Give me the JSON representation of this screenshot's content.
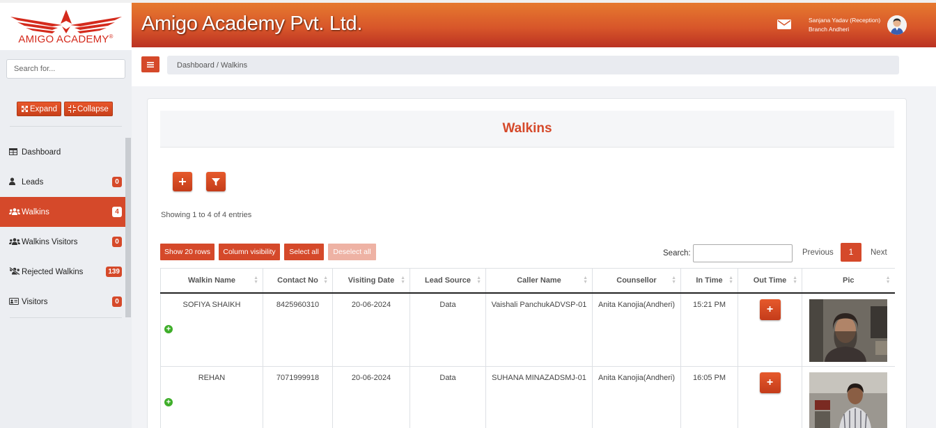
{
  "brand": {
    "logo_text": "AMIGO ACADEMY",
    "logo_reg": "®",
    "app_title": "Amigo Academy Pvt. Ltd.",
    "accent": "#d5492a"
  },
  "user": {
    "name_role": "Sanjana Yadav (Reception)",
    "branch": "Branch Andheri"
  },
  "sidebar": {
    "search_placeholder": "Search for...",
    "expand_label": "Expand",
    "collapse_label": "Collapse",
    "items": [
      {
        "label": "Dashboard",
        "icon": "dashboard-icon",
        "badge": ""
      },
      {
        "label": "Leads",
        "icon": "user-icon",
        "badge": "0"
      },
      {
        "label": "Walkins",
        "icon": "users-icon",
        "badge": "4",
        "active": true
      },
      {
        "label": "Walkins Visitors",
        "icon": "users-icon",
        "badge": "0"
      },
      {
        "label": "Rejected Walkins",
        "icon": "users-slash-icon",
        "badge": "139"
      },
      {
        "label": "Visitors",
        "icon": "id-card-icon",
        "badge": "0"
      }
    ]
  },
  "breadcrumb": "Dashboard / Walkins",
  "page": {
    "title": "Walkins",
    "info": "Showing 1 to 4 of 4 entries",
    "toolbar": {
      "show_rows": "Show 20 rows",
      "column_visibility": "Column visibility",
      "select_all": "Select all",
      "deselect_all": "Deselect all"
    },
    "search_label": "Search:",
    "pagination": {
      "prev": "Previous",
      "current": "1",
      "next": "Next"
    }
  },
  "table": {
    "columns": [
      "Walkin Name",
      "Contact No",
      "Visiting Date",
      "Lead Source",
      "Caller Name",
      "Counsellor",
      "In Time",
      "Out Time",
      "Pic"
    ],
    "rows": [
      {
        "name": "SOFIYA SHAIKH",
        "contact": "8425960310",
        "date": "20-06-2024",
        "source": "Data",
        "caller": "Vaishali PanchukADVSP-01",
        "counsellor": "Anita Kanojia(Andheri)",
        "in_time": "15:21 PM"
      },
      {
        "name": "REHAN",
        "contact": "7071999918",
        "date": "20-06-2024",
        "source": "Data",
        "caller": "SUHANA MINAZADSMJ-01",
        "counsellor": "Anita Kanojia(Andheri)",
        "in_time": "16:05 PM"
      }
    ]
  }
}
